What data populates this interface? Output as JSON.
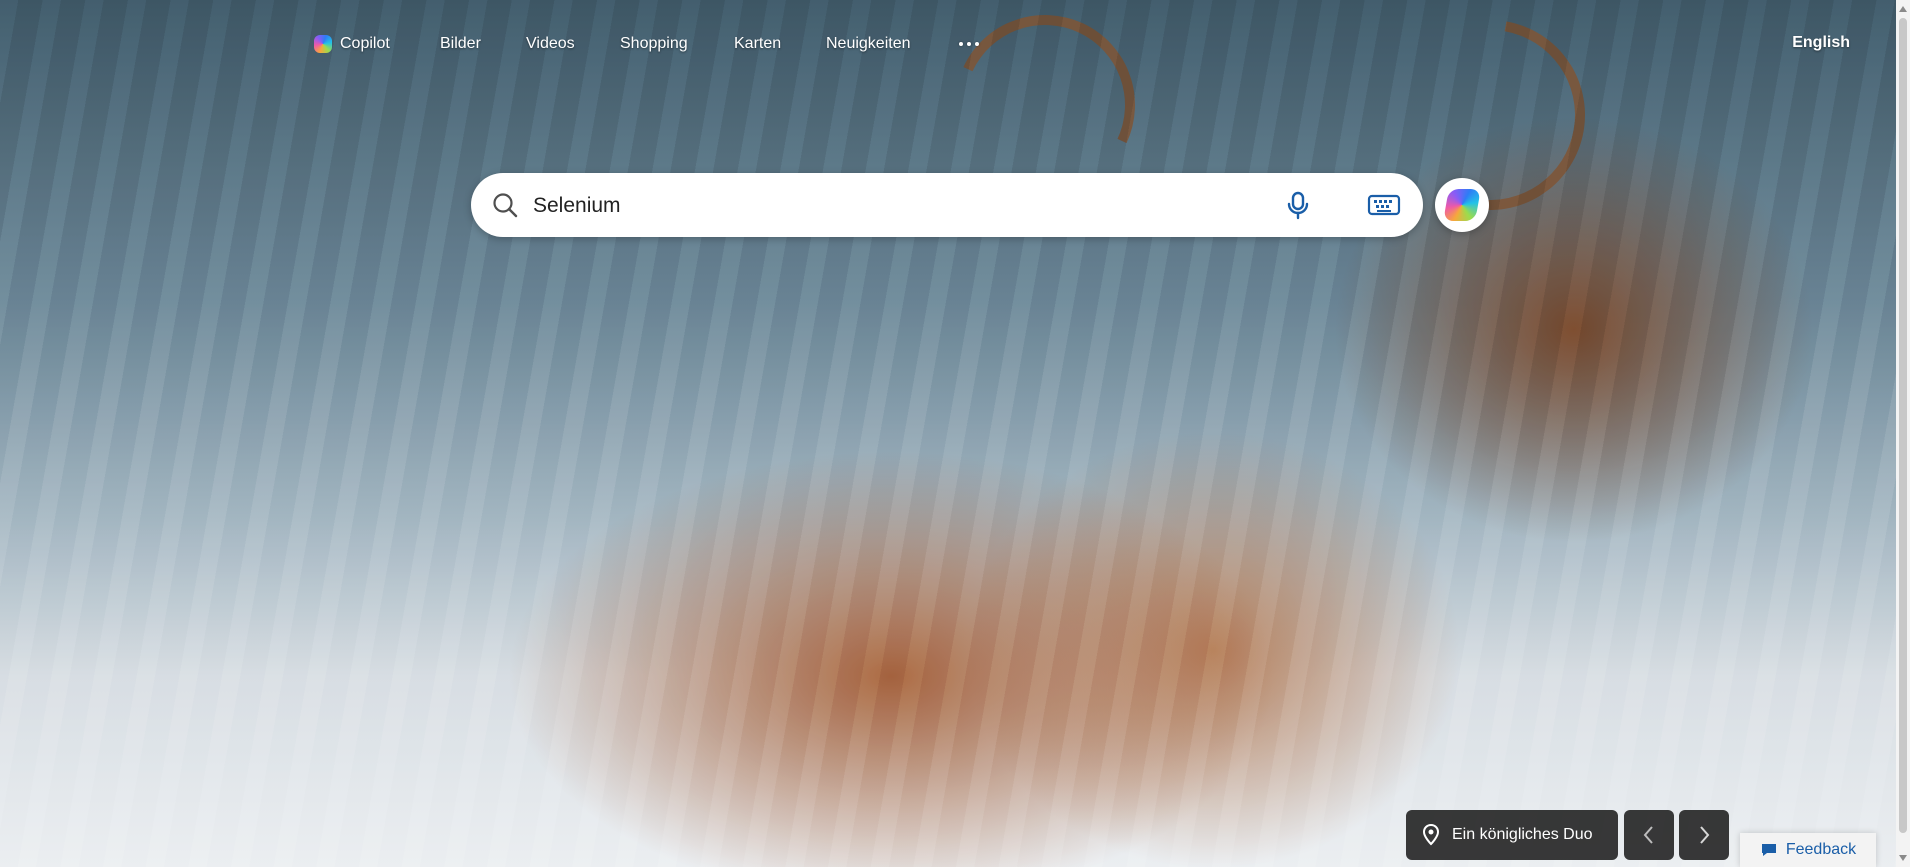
{
  "nav": {
    "items": [
      {
        "label": "Copilot",
        "icon": "copilot-icon"
      },
      {
        "label": "Bilder"
      },
      {
        "label": "Videos"
      },
      {
        "label": "Shopping"
      },
      {
        "label": "Karten"
      },
      {
        "label": "Neuigkeiten"
      }
    ],
    "more_icon": "more-icon",
    "language": "English"
  },
  "search": {
    "value": "Selenium",
    "placeholder": ""
  },
  "caption": {
    "text": "Ein königliches Duo",
    "icon": "location-pin-icon"
  },
  "feedback": {
    "label": "Feedback",
    "icon": "feedback-icon"
  },
  "colors": {
    "accent": "#1a5ea8",
    "overlay": "#1e1e1e"
  }
}
